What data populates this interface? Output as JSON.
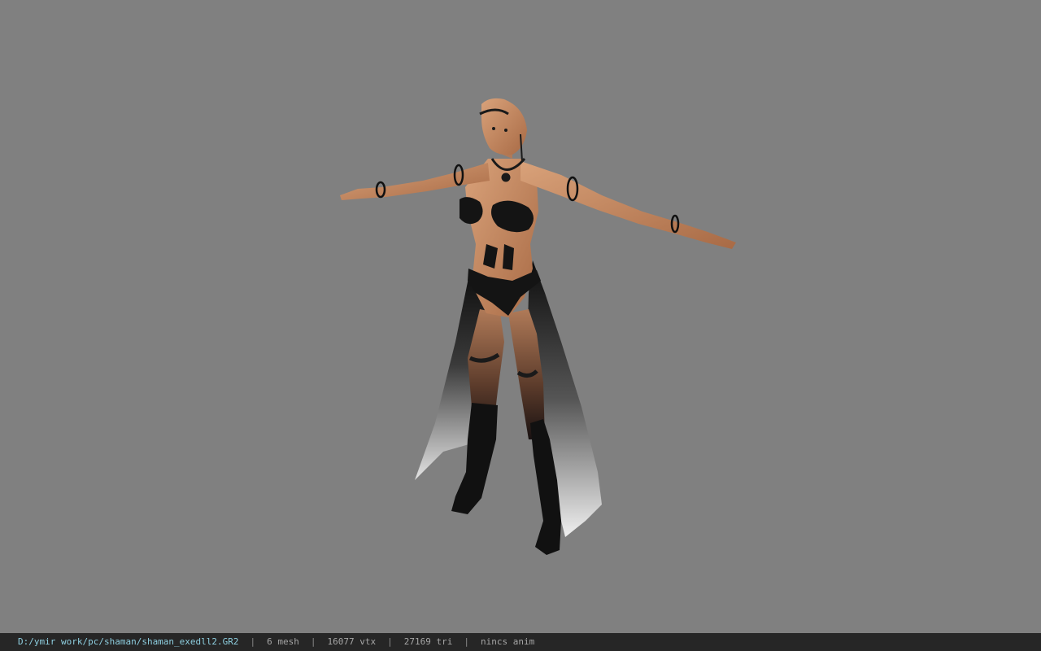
{
  "viewer": {
    "background_color": "#808080",
    "subject_icon": "character-model"
  },
  "status_bar": {
    "file_path": "D:/ymir work/pc/shaman/shaman_exedll2.GR2",
    "separator": "|",
    "mesh_count": "6 mesh",
    "vertex_count": "16077 vtx",
    "triangle_count": "27169 tri",
    "anim": "nincs anim",
    "path_color": "#8ecfe0",
    "bar_color": "#262626"
  }
}
